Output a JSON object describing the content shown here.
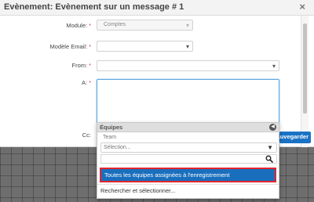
{
  "dialog": {
    "title": "Evènement: Evènement sur un message # 1",
    "close_label": "×"
  },
  "form": {
    "required_marker": "*",
    "module": {
      "label": "Module:",
      "value": "Comptes"
    },
    "email_template": {
      "label": "Modèle Email:",
      "value": ""
    },
    "from": {
      "label": "From:",
      "value": ""
    },
    "to": {
      "label": "A:",
      "value": ""
    },
    "cc": {
      "label": "Cc:"
    }
  },
  "dropdown": {
    "group_title": "Équipes",
    "team_label": "Team",
    "select_placeholder": "Sélection...",
    "selected_option": "Toutes les équipes assignées à l'enregistrement",
    "search_option": "Rechercher et sélectionner..."
  },
  "save_button_label": "Sauvegarder",
  "colors": {
    "accent_blue": "#1a6fbd",
    "highlight_border": "#e3252d",
    "required_red": "#e04040"
  },
  "icons": {
    "close": "close-icon",
    "caret": "caret-down-icon",
    "group_toggle": "chevron-left-circle-icon",
    "search": "search-icon"
  }
}
